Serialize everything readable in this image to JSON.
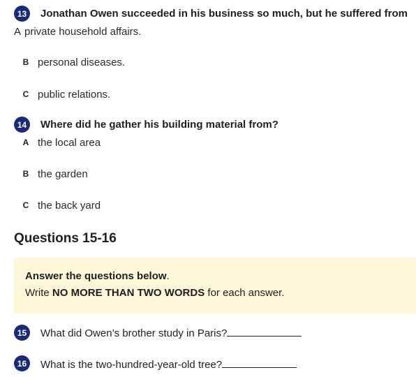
{
  "q13": {
    "number": "13",
    "text": "Jonathan Owen succeeded in his business so much, but he suffered from",
    "option_a": {
      "letter": "A",
      "text": "private household affairs."
    },
    "option_b": {
      "letter": "B",
      "text": "personal diseases."
    },
    "option_c": {
      "letter": "C",
      "text": "public relations."
    }
  },
  "q14": {
    "number": "14",
    "text": "Where did he gather his building material from?",
    "option_a": {
      "letter": "A",
      "text": "the local area"
    },
    "option_b": {
      "letter": "B",
      "text": "the garden"
    },
    "option_c": {
      "letter": "C",
      "text": "the back yard"
    }
  },
  "section": {
    "heading": "Questions 15-16",
    "instruction_bold": "Answer the questions below",
    "instruction_bold_suffix": ".",
    "instruction_prefix": "Write ",
    "instruction_emphasis": "NO MORE THAN TWO WORDS",
    "instruction_suffix": " for each answer."
  },
  "q15": {
    "number": "15",
    "text": "What did Owen’s brother study in Paris?"
  },
  "q16": {
    "number": "16",
    "text": "What is the two-hundred-year-old tree?"
  }
}
